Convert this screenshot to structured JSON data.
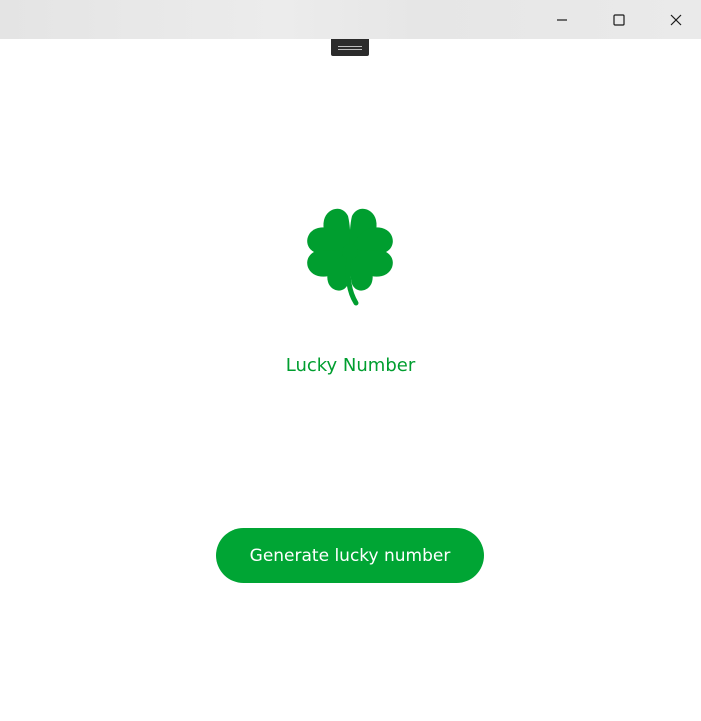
{
  "window": {
    "controls": {
      "minimize_icon": "minimize-icon",
      "maximize_icon": "maximize-icon",
      "close_icon": "close-icon"
    }
  },
  "main": {
    "logo_icon": "four-leaf-clover-icon",
    "title": "Lucky Number",
    "generate_button_label": "Generate lucky number"
  },
  "colors": {
    "accent": "#00a534",
    "title_text": "#009e2f",
    "clover": "#009e2f",
    "button_text": "#ffffff",
    "background": "#ffffff"
  }
}
